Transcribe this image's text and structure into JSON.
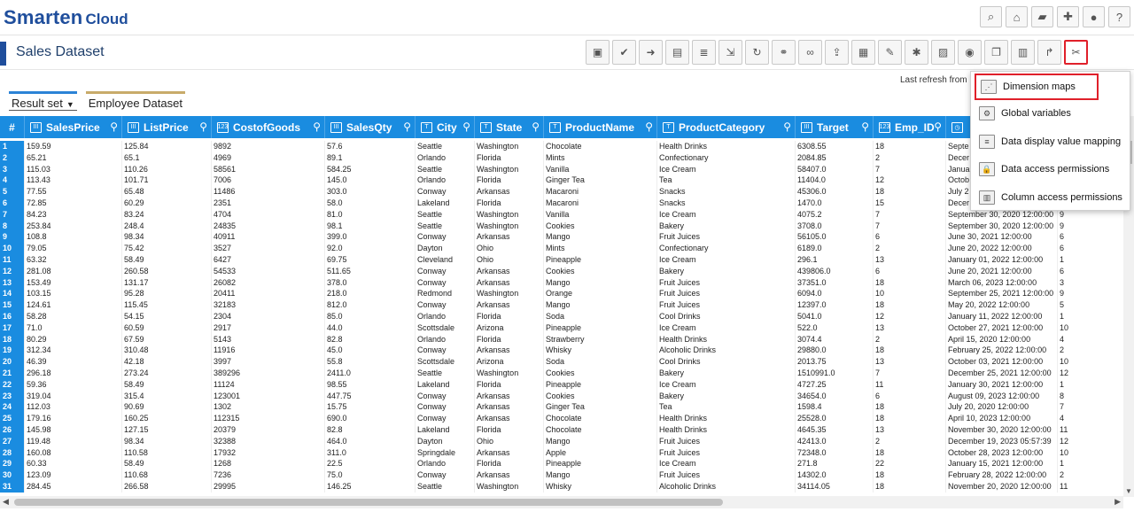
{
  "app": {
    "brand": "Smarten",
    "brand_sub": "Cloud"
  },
  "header_icons": [
    "search-icon",
    "home-icon",
    "folder-icon",
    "plus-icon",
    "user-icon",
    "help-icon"
  ],
  "page": {
    "title": "Sales Dataset"
  },
  "toolbar_icons": [
    "save-icon",
    "edit-check-icon",
    "export-icon",
    "csv-icon",
    "database-icon",
    "import-icon",
    "refresh-import-icon",
    "join-icon",
    "link-icon",
    "upload-icon",
    "grid-icon",
    "chart-icon",
    "settings-icon",
    "image-icon",
    "preview-icon",
    "copy-icon",
    "table-icon",
    "shortcut-icon",
    "tools-icon"
  ],
  "refresh_text": "Last refresh from",
  "tabs": [
    {
      "label": "Result set"
    },
    {
      "label": "Employee Dataset"
    }
  ],
  "columns": [
    "SalesPrice",
    "ListPrice",
    "CostofGoods",
    "SalesQty",
    "City",
    "State",
    "ProductName",
    "ProductCategory",
    "Target",
    "Emp_ID"
  ],
  "row_header": "#",
  "menu": {
    "items": [
      {
        "label": "Dimension maps",
        "icon": "dimension-map-icon",
        "highlighted": true
      },
      {
        "label": "Global variables",
        "icon": "global-variables-icon"
      },
      {
        "label": "Data display value mapping",
        "icon": "value-mapping-icon"
      },
      {
        "label": "Data access permissions",
        "icon": "data-access-icon"
      },
      {
        "label": "Column access permissions",
        "icon": "column-access-icon"
      }
    ]
  },
  "colors": {
    "accent": "#1a8ce0",
    "brand": "#1f4e9c",
    "highlight": "#e0202a",
    "tab_gold": "#c8ab6a"
  },
  "rows": [
    [
      "1",
      "159.59",
      "125.84",
      "9892",
      "57.6",
      "Seattle",
      "Washington",
      "Chocolate",
      "Health Drinks",
      "6308.55",
      "18",
      "Septe"
    ],
    [
      "2",
      "65.21",
      "65.1",
      "4969",
      "89.1",
      "Orlando",
      "Florida",
      "Mints",
      "Confectionary",
      "2084.85",
      "2",
      "Decer"
    ],
    [
      "3",
      "115.03",
      "110.26",
      "58561",
      "584.25",
      "Seattle",
      "Washington",
      "Vanilla",
      "Ice Cream",
      "58407.0",
      "7",
      "Janua"
    ],
    [
      "4",
      "113.43",
      "101.71",
      "7006",
      "145.0",
      "Orlando",
      "Florida",
      "Ginger Tea",
      "Tea",
      "11404.0",
      "12",
      "Octob"
    ],
    [
      "5",
      "77.55",
      "65.48",
      "11486",
      "303.0",
      "Conway",
      "Arkansas",
      "Macaroni",
      "Snacks",
      "45306.0",
      "18",
      "July 2"
    ],
    [
      "6",
      "72.85",
      "60.29",
      "2351",
      "58.0",
      "Lakeland",
      "Florida",
      "Macaroni",
      "Snacks",
      "1470.0",
      "15",
      "Decer"
    ],
    [
      "7",
      "84.23",
      "83.24",
      "4704",
      "81.0",
      "Seattle",
      "Washington",
      "Vanilla",
      "Ice Cream",
      "4075.2",
      "7",
      "September 30, 2020 12:00:00",
      "9"
    ],
    [
      "8",
      "253.84",
      "248.4",
      "24835",
      "98.1",
      "Seattle",
      "Washington",
      "Cookies",
      "Bakery",
      "3708.0",
      "7",
      "September 30, 2020 12:00:00",
      "9"
    ],
    [
      "9",
      "108.8",
      "98.34",
      "40911",
      "399.0",
      "Conway",
      "Arkansas",
      "Mango",
      "Fruit Juices",
      "56105.0",
      "6",
      "June 30, 2021 12:00:00",
      "6"
    ],
    [
      "10",
      "79.05",
      "75.42",
      "3527",
      "92.0",
      "Dayton",
      "Ohio",
      "Mints",
      "Confectionary",
      "6189.0",
      "2",
      "June 20, 2022 12:00:00",
      "6"
    ],
    [
      "11",
      "63.32",
      "58.49",
      "6427",
      "69.75",
      "Cleveland",
      "Ohio",
      "Pineapple",
      "Ice Cream",
      "296.1",
      "13",
      "January 01, 2022 12:00:00",
      "1"
    ],
    [
      "12",
      "281.08",
      "260.58",
      "54533",
      "511.65",
      "Conway",
      "Arkansas",
      "Cookies",
      "Bakery",
      "439806.0",
      "6",
      "June 20, 2021 12:00:00",
      "6"
    ],
    [
      "13",
      "153.49",
      "131.17",
      "26082",
      "378.0",
      "Conway",
      "Arkansas",
      "Mango",
      "Fruit Juices",
      "37351.0",
      "18",
      "March 06, 2023 12:00:00",
      "3"
    ],
    [
      "14",
      "103.15",
      "95.28",
      "20411",
      "218.0",
      "Redmond",
      "Washington",
      "Orange",
      "Fruit Juices",
      "6094.0",
      "10",
      "September 25, 2021 12:00:00",
      "9"
    ],
    [
      "15",
      "124.61",
      "115.45",
      "32183",
      "812.0",
      "Conway",
      "Arkansas",
      "Mango",
      "Fruit Juices",
      "12397.0",
      "18",
      "May 20, 2022 12:00:00",
      "5"
    ],
    [
      "16",
      "58.28",
      "54.15",
      "2304",
      "85.0",
      "Orlando",
      "Florida",
      "Soda",
      "Cool Drinks",
      "5041.0",
      "12",
      "January 11, 2022 12:00:00",
      "1"
    ],
    [
      "17",
      "71.0",
      "60.59",
      "2917",
      "44.0",
      "Scottsdale",
      "Arizona",
      "Pineapple",
      "Ice Cream",
      "522.0",
      "13",
      "October 27, 2021 12:00:00",
      "10"
    ],
    [
      "18",
      "80.29",
      "67.59",
      "5143",
      "82.8",
      "Orlando",
      "Florida",
      "Strawberry",
      "Health Drinks",
      "3074.4",
      "2",
      "April 15, 2020 12:00:00",
      "4"
    ],
    [
      "19",
      "312.34",
      "310.48",
      "11916",
      "45.0",
      "Conway",
      "Arkansas",
      "Whisky",
      "Alcoholic Drinks",
      "29880.0",
      "18",
      "February 25, 2022 12:00:00",
      "2"
    ],
    [
      "20",
      "46.39",
      "42.18",
      "3997",
      "55.8",
      "Scottsdale",
      "Arizona",
      "Soda",
      "Cool Drinks",
      "2013.75",
      "13",
      "October 03, 2021 12:00:00",
      "10"
    ],
    [
      "21",
      "296.18",
      "273.24",
      "389296",
      "2411.0",
      "Seattle",
      "Washington",
      "Cookies",
      "Bakery",
      "1510991.0",
      "7",
      "December 25, 2021 12:00:00",
      "12"
    ],
    [
      "22",
      "59.36",
      "58.49",
      "11124",
      "98.55",
      "Lakeland",
      "Florida",
      "Pineapple",
      "Ice Cream",
      "4727.25",
      "11",
      "January 30, 2021 12:00:00",
      "1"
    ],
    [
      "23",
      "319.04",
      "315.4",
      "123001",
      "447.75",
      "Conway",
      "Arkansas",
      "Cookies",
      "Bakery",
      "34654.0",
      "6",
      "August 09, 2023 12:00:00",
      "8"
    ],
    [
      "24",
      "112.03",
      "90.69",
      "1302",
      "15.75",
      "Conway",
      "Arkansas",
      "Ginger Tea",
      "Tea",
      "1598.4",
      "18",
      "July 20, 2020 12:00:00",
      "7"
    ],
    [
      "25",
      "179.16",
      "160.25",
      "112315",
      "690.0",
      "Conway",
      "Arkansas",
      "Chocolate",
      "Health Drinks",
      "25528.0",
      "18",
      "April 10, 2023 12:00:00",
      "4"
    ],
    [
      "26",
      "145.98",
      "127.15",
      "20379",
      "82.8",
      "Lakeland",
      "Florida",
      "Chocolate",
      "Health Drinks",
      "4645.35",
      "13",
      "November 30, 2020 12:00:00",
      "11"
    ],
    [
      "27",
      "119.48",
      "98.34",
      "32388",
      "464.0",
      "Dayton",
      "Ohio",
      "Mango",
      "Fruit Juices",
      "42413.0",
      "2",
      "December 19, 2023 05:57:39",
      "12"
    ],
    [
      "28",
      "160.08",
      "110.58",
      "17932",
      "311.0",
      "Springdale",
      "Arkansas",
      "Apple",
      "Fruit Juices",
      "72348.0",
      "18",
      "October 28, 2023 12:00:00",
      "10"
    ],
    [
      "29",
      "60.33",
      "58.49",
      "1268",
      "22.5",
      "Orlando",
      "Florida",
      "Pineapple",
      "Ice Cream",
      "271.8",
      "22",
      "January 15, 2021 12:00:00",
      "1"
    ],
    [
      "30",
      "123.09",
      "110.68",
      "7236",
      "75.0",
      "Conway",
      "Arkansas",
      "Mango",
      "Fruit Juices",
      "14302.0",
      "18",
      "February 28, 2022 12:00:00",
      "2"
    ],
    [
      "31",
      "284.45",
      "266.58",
      "29995",
      "146.25",
      "Seattle",
      "Washington",
      "Whisky",
      "Alcoholic Drinks",
      "34114.05",
      "18",
      "November 20, 2020 12:00:00",
      "11"
    ]
  ]
}
